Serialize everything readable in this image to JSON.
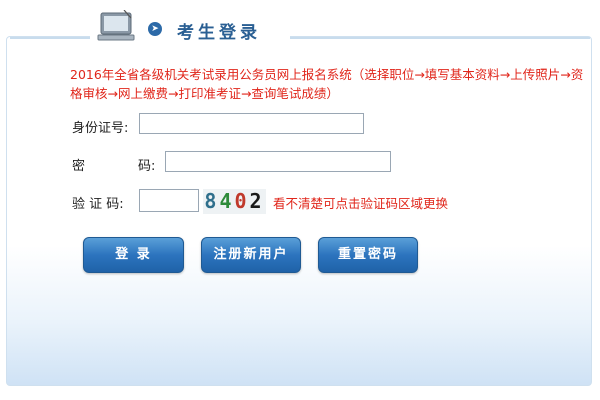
{
  "header": {
    "title": "考生登录",
    "bullet_icon": "arrow-right-icon"
  },
  "notice": "2016年全省各级机关考试录用公务员网上报名系统（选择职位→填写基本资料→上传照片→资格审核→网上缴费→打印准考证→查询笔试成绩）",
  "form": {
    "id_label": "身份证号:",
    "id_value": "",
    "password_label_a": "密",
    "password_label_b": "码:",
    "password_value": "",
    "captcha_label": "验 证 码:",
    "captcha_value": "",
    "captcha_digits": [
      "8",
      "4",
      "0",
      "2"
    ],
    "captcha_hint": "看不清楚可点击验证码区域更换"
  },
  "buttons": {
    "login": "登 录",
    "register": "注册新用户",
    "reset_password": "重置密码"
  },
  "colors": {
    "accent": "#2c74be",
    "notice": "#e0261b",
    "title": "#2a5f93"
  }
}
